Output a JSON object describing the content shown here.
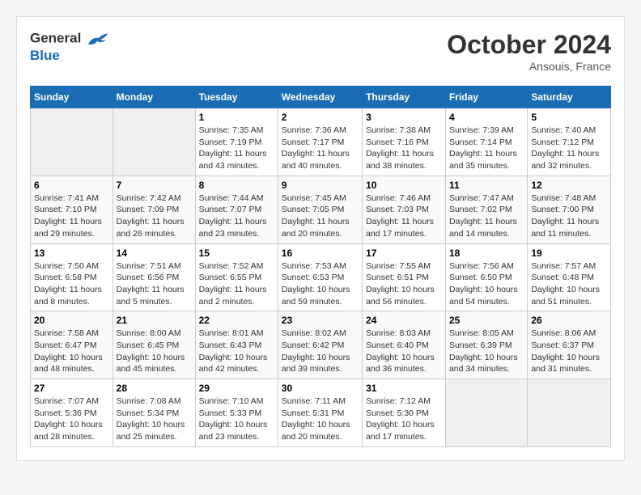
{
  "header": {
    "logo_line1": "General",
    "logo_line2": "Blue",
    "month": "October 2024",
    "location": "Ansouis, France"
  },
  "days_of_week": [
    "Sunday",
    "Monday",
    "Tuesday",
    "Wednesday",
    "Thursday",
    "Friday",
    "Saturday"
  ],
  "weeks": [
    [
      {
        "num": "",
        "sunrise": "",
        "sunset": "",
        "daylight": "",
        "empty": true
      },
      {
        "num": "",
        "sunrise": "",
        "sunset": "",
        "daylight": "",
        "empty": true
      },
      {
        "num": "1",
        "sunrise": "Sunrise: 7:35 AM",
        "sunset": "Sunset: 7:19 PM",
        "daylight": "Daylight: 11 hours and 43 minutes."
      },
      {
        "num": "2",
        "sunrise": "Sunrise: 7:36 AM",
        "sunset": "Sunset: 7:17 PM",
        "daylight": "Daylight: 11 hours and 40 minutes."
      },
      {
        "num": "3",
        "sunrise": "Sunrise: 7:38 AM",
        "sunset": "Sunset: 7:16 PM",
        "daylight": "Daylight: 11 hours and 38 minutes."
      },
      {
        "num": "4",
        "sunrise": "Sunrise: 7:39 AM",
        "sunset": "Sunset: 7:14 PM",
        "daylight": "Daylight: 11 hours and 35 minutes."
      },
      {
        "num": "5",
        "sunrise": "Sunrise: 7:40 AM",
        "sunset": "Sunset: 7:12 PM",
        "daylight": "Daylight: 11 hours and 32 minutes."
      }
    ],
    [
      {
        "num": "6",
        "sunrise": "Sunrise: 7:41 AM",
        "sunset": "Sunset: 7:10 PM",
        "daylight": "Daylight: 11 hours and 29 minutes."
      },
      {
        "num": "7",
        "sunrise": "Sunrise: 7:42 AM",
        "sunset": "Sunset: 7:09 PM",
        "daylight": "Daylight: 11 hours and 26 minutes."
      },
      {
        "num": "8",
        "sunrise": "Sunrise: 7:44 AM",
        "sunset": "Sunset: 7:07 PM",
        "daylight": "Daylight: 11 hours and 23 minutes."
      },
      {
        "num": "9",
        "sunrise": "Sunrise: 7:45 AM",
        "sunset": "Sunset: 7:05 PM",
        "daylight": "Daylight: 11 hours and 20 minutes."
      },
      {
        "num": "10",
        "sunrise": "Sunrise: 7:46 AM",
        "sunset": "Sunset: 7:03 PM",
        "daylight": "Daylight: 11 hours and 17 minutes."
      },
      {
        "num": "11",
        "sunrise": "Sunrise: 7:47 AM",
        "sunset": "Sunset: 7:02 PM",
        "daylight": "Daylight: 11 hours and 14 minutes."
      },
      {
        "num": "12",
        "sunrise": "Sunrise: 7:48 AM",
        "sunset": "Sunset: 7:00 PM",
        "daylight": "Daylight: 11 hours and 11 minutes."
      }
    ],
    [
      {
        "num": "13",
        "sunrise": "Sunrise: 7:50 AM",
        "sunset": "Sunset: 6:58 PM",
        "daylight": "Daylight: 11 hours and 8 minutes."
      },
      {
        "num": "14",
        "sunrise": "Sunrise: 7:51 AM",
        "sunset": "Sunset: 6:56 PM",
        "daylight": "Daylight: 11 hours and 5 minutes."
      },
      {
        "num": "15",
        "sunrise": "Sunrise: 7:52 AM",
        "sunset": "Sunset: 6:55 PM",
        "daylight": "Daylight: 11 hours and 2 minutes."
      },
      {
        "num": "16",
        "sunrise": "Sunrise: 7:53 AM",
        "sunset": "Sunset: 6:53 PM",
        "daylight": "Daylight: 10 hours and 59 minutes."
      },
      {
        "num": "17",
        "sunrise": "Sunrise: 7:55 AM",
        "sunset": "Sunset: 6:51 PM",
        "daylight": "Daylight: 10 hours and 56 minutes."
      },
      {
        "num": "18",
        "sunrise": "Sunrise: 7:56 AM",
        "sunset": "Sunset: 6:50 PM",
        "daylight": "Daylight: 10 hours and 54 minutes."
      },
      {
        "num": "19",
        "sunrise": "Sunrise: 7:57 AM",
        "sunset": "Sunset: 6:48 PM",
        "daylight": "Daylight: 10 hours and 51 minutes."
      }
    ],
    [
      {
        "num": "20",
        "sunrise": "Sunrise: 7:58 AM",
        "sunset": "Sunset: 6:47 PM",
        "daylight": "Daylight: 10 hours and 48 minutes."
      },
      {
        "num": "21",
        "sunrise": "Sunrise: 8:00 AM",
        "sunset": "Sunset: 6:45 PM",
        "daylight": "Daylight: 10 hours and 45 minutes."
      },
      {
        "num": "22",
        "sunrise": "Sunrise: 8:01 AM",
        "sunset": "Sunset: 6:43 PM",
        "daylight": "Daylight: 10 hours and 42 minutes."
      },
      {
        "num": "23",
        "sunrise": "Sunrise: 8:02 AM",
        "sunset": "Sunset: 6:42 PM",
        "daylight": "Daylight: 10 hours and 39 minutes."
      },
      {
        "num": "24",
        "sunrise": "Sunrise: 8:03 AM",
        "sunset": "Sunset: 6:40 PM",
        "daylight": "Daylight: 10 hours and 36 minutes."
      },
      {
        "num": "25",
        "sunrise": "Sunrise: 8:05 AM",
        "sunset": "Sunset: 6:39 PM",
        "daylight": "Daylight: 10 hours and 34 minutes."
      },
      {
        "num": "26",
        "sunrise": "Sunrise: 8:06 AM",
        "sunset": "Sunset: 6:37 PM",
        "daylight": "Daylight: 10 hours and 31 minutes."
      }
    ],
    [
      {
        "num": "27",
        "sunrise": "Sunrise: 7:07 AM",
        "sunset": "Sunset: 5:36 PM",
        "daylight": "Daylight: 10 hours and 28 minutes."
      },
      {
        "num": "28",
        "sunrise": "Sunrise: 7:08 AM",
        "sunset": "Sunset: 5:34 PM",
        "daylight": "Daylight: 10 hours and 25 minutes."
      },
      {
        "num": "29",
        "sunrise": "Sunrise: 7:10 AM",
        "sunset": "Sunset: 5:33 PM",
        "daylight": "Daylight: 10 hours and 23 minutes."
      },
      {
        "num": "30",
        "sunrise": "Sunrise: 7:11 AM",
        "sunset": "Sunset: 5:31 PM",
        "daylight": "Daylight: 10 hours and 20 minutes."
      },
      {
        "num": "31",
        "sunrise": "Sunrise: 7:12 AM",
        "sunset": "Sunset: 5:30 PM",
        "daylight": "Daylight: 10 hours and 17 minutes."
      },
      {
        "num": "",
        "sunrise": "",
        "sunset": "",
        "daylight": "",
        "empty": true
      },
      {
        "num": "",
        "sunrise": "",
        "sunset": "",
        "daylight": "",
        "empty": true
      }
    ]
  ]
}
